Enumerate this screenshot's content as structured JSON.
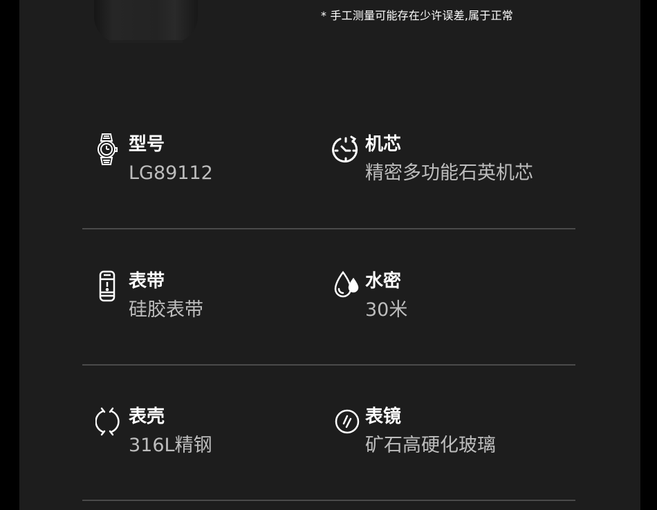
{
  "note": "* 手工测量可能存在少许误差,属于正常",
  "specs": [
    {
      "icon": "watch-icon",
      "title": "型号",
      "value": "LG89112"
    },
    {
      "icon": "movement-dial-icon",
      "title": "机芯",
      "value": "精密多功能石英机芯"
    },
    {
      "icon": "strap-icon",
      "title": "表带",
      "value": "硅胶表带"
    },
    {
      "icon": "water-drop-icon",
      "title": "水密",
      "value": "30米"
    },
    {
      "icon": "case-icon",
      "title": "表壳",
      "value": "316L精钢"
    },
    {
      "icon": "crystal-icon",
      "title": "表镜",
      "value": "矿石高硬化玻璃"
    }
  ],
  "colors": {
    "background": "#1d1d1d",
    "outer": "#000000",
    "title": "#ffffff",
    "value": "#bdbdbd",
    "divider": "#4a4a4a"
  }
}
